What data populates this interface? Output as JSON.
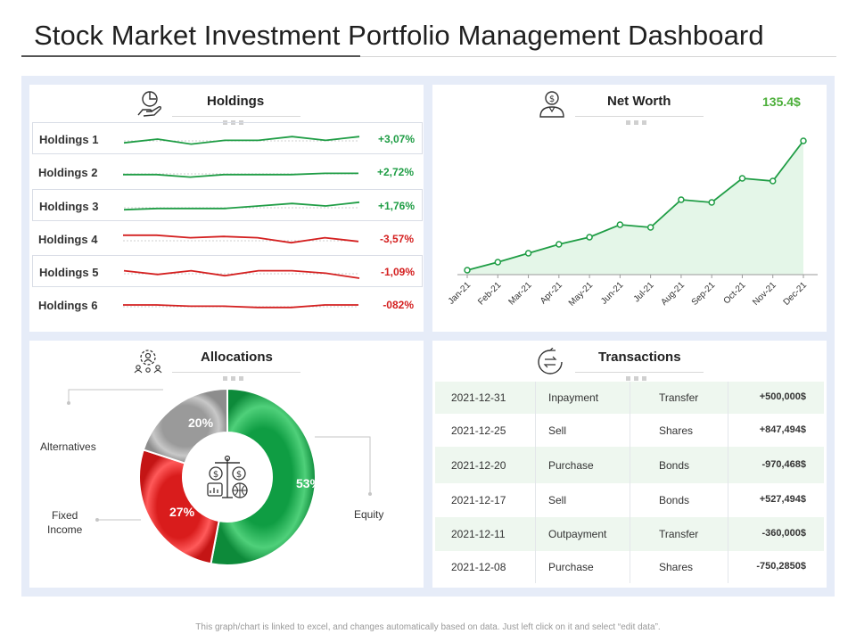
{
  "title": "Stock Market Investment Portfolio Management Dashboard",
  "footer": "This graph/chart is linked to excel, and changes automatically based on data. Just left click on it and select “edit data”.",
  "colors": {
    "positive": "#1f9d45",
    "negative": "#d42020",
    "frame": "#e6ecf8",
    "equity": "#16a34a",
    "fixed_income": "#e02424",
    "alternatives": "#9e9e9e",
    "net_worth_line": "#1f9d45",
    "net_worth_fill": "#e4f6e8"
  },
  "holdings": {
    "title": "Holdings",
    "icon": "hand-chart-icon",
    "items": [
      {
        "label": "Holdings 1",
        "value": "+3,07%",
        "trend": "positive"
      },
      {
        "label": "Holdings 2",
        "value": "+2,72%",
        "trend": "positive"
      },
      {
        "label": "Holdings 3",
        "value": "+1,76%",
        "trend": "positive"
      },
      {
        "label": "Holdings 4",
        "value": "-3,57%",
        "trend": "negative"
      },
      {
        "label": "Holdings 5",
        "value": "-1,09%",
        "trend": "negative"
      },
      {
        "label": "Holdings 6",
        "value": "-082%",
        "trend": "negative"
      }
    ]
  },
  "net_worth": {
    "title": "Net Worth",
    "value": "135.4$",
    "icon": "person-dollar-icon"
  },
  "allocations": {
    "title": "Allocations",
    "icon": "people-gear-icon",
    "center_icon": "finance-scale-icon",
    "labels": {
      "alternatives": "Alternatives",
      "fixed_income_line1": "Fixed",
      "fixed_income_line2": "Income",
      "equity": "Equity"
    }
  },
  "transactions": {
    "title": "Transactions",
    "icon": "exchange-arrows-icon",
    "rows": [
      {
        "date": "2021-12-31",
        "type": "Inpayment",
        "category": "Transfer",
        "amount": "+500,000$"
      },
      {
        "date": "2021-12-25",
        "type": "Sell",
        "category": "Shares",
        "amount": "+847,494$"
      },
      {
        "date": "2021-12-20",
        "type": "Purchase",
        "category": "Bonds",
        "amount": "-970,468$"
      },
      {
        "date": "2021-12-17",
        "type": "Sell",
        "category": "Bonds",
        "amount": "+527,494$"
      },
      {
        "date": "2021-12-11",
        "type": "Outpayment",
        "category": "Transfer",
        "amount": "-360,000$"
      },
      {
        "date": "2021-12-08",
        "type": "Purchase",
        "category": "Shares",
        "amount": "-750,2850$"
      }
    ]
  },
  "chart_data": [
    {
      "type": "line",
      "title": "Net Worth",
      "x": [
        "Jan-21",
        "Feb-21",
        "Mar-21",
        "Apr-21",
        "May-21",
        "Jun-21",
        "Jul-21",
        "Aug-21",
        "Sep-21",
        "Oct-21",
        "Nov-21",
        "Dec-21"
      ],
      "y": [
        5,
        14,
        24,
        34,
        42,
        56,
        53,
        84,
        81,
        108,
        105,
        150
      ],
      "ylim": [
        0,
        160
      ],
      "area_fill": true,
      "grid": false
    },
    {
      "type": "pie",
      "title": "Allocations",
      "donut": true,
      "slices": [
        {
          "label": "Equity",
          "value": 53,
          "display": "53%"
        },
        {
          "label": "Fixed Income",
          "value": 27,
          "display": "27%"
        },
        {
          "label": "Alternatives",
          "value": 20,
          "display": "20%"
        }
      ]
    },
    {
      "type": "line",
      "title": "Holdings sparklines",
      "series": [
        {
          "name": "Holdings 1",
          "values": [
            2,
            5,
            1,
            4,
            4,
            7,
            4,
            7
          ]
        },
        {
          "name": "Holdings 2",
          "values": [
            3,
            3,
            1,
            3,
            3,
            3,
            4,
            4
          ]
        },
        {
          "name": "Holdings 3",
          "values": [
            2,
            3,
            3,
            3,
            5,
            7,
            5,
            8
          ]
        },
        {
          "name": "Holdings 4",
          "values": [
            8,
            8,
            6,
            7,
            6,
            2,
            6,
            3
          ]
        },
        {
          "name": "Holdings 5",
          "values": [
            6,
            3,
            6,
            2,
            6,
            6,
            4,
            0
          ]
        },
        {
          "name": "Holdings 6",
          "values": [
            5,
            5,
            4,
            4,
            3,
            3,
            5,
            5
          ]
        }
      ]
    }
  ]
}
